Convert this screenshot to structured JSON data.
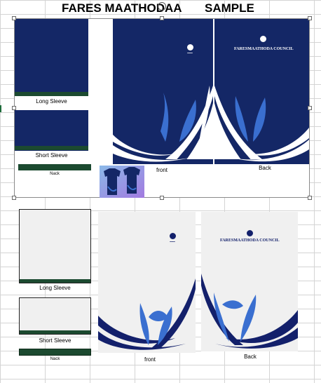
{
  "sheet": {
    "title": "FARES MAATHODAA       SAMPLE"
  },
  "colors": {
    "navy": "#142766",
    "collar_green": "#1c4a30",
    "wave_light": "#3a6fd0",
    "wave_deep": "#13206b",
    "light_panel": "#f0f0f0"
  },
  "top_design": {
    "long_sleeve_label": "Long Sleeve",
    "short_sleeve_label": "Short Sleeve",
    "nack_label": "Nack",
    "front_label": "front",
    "back_label": "Back",
    "council_name": "FARESMAATHODA COUNCIL"
  },
  "bottom_design": {
    "long_sleeve_label": "Long Sleeve",
    "short_sleeve_label": "Short Sleeve",
    "nack_label": "Nack",
    "front_label": "front",
    "back_label": "Back",
    "council_name": "FARESMAATHODA COUNCIL"
  }
}
